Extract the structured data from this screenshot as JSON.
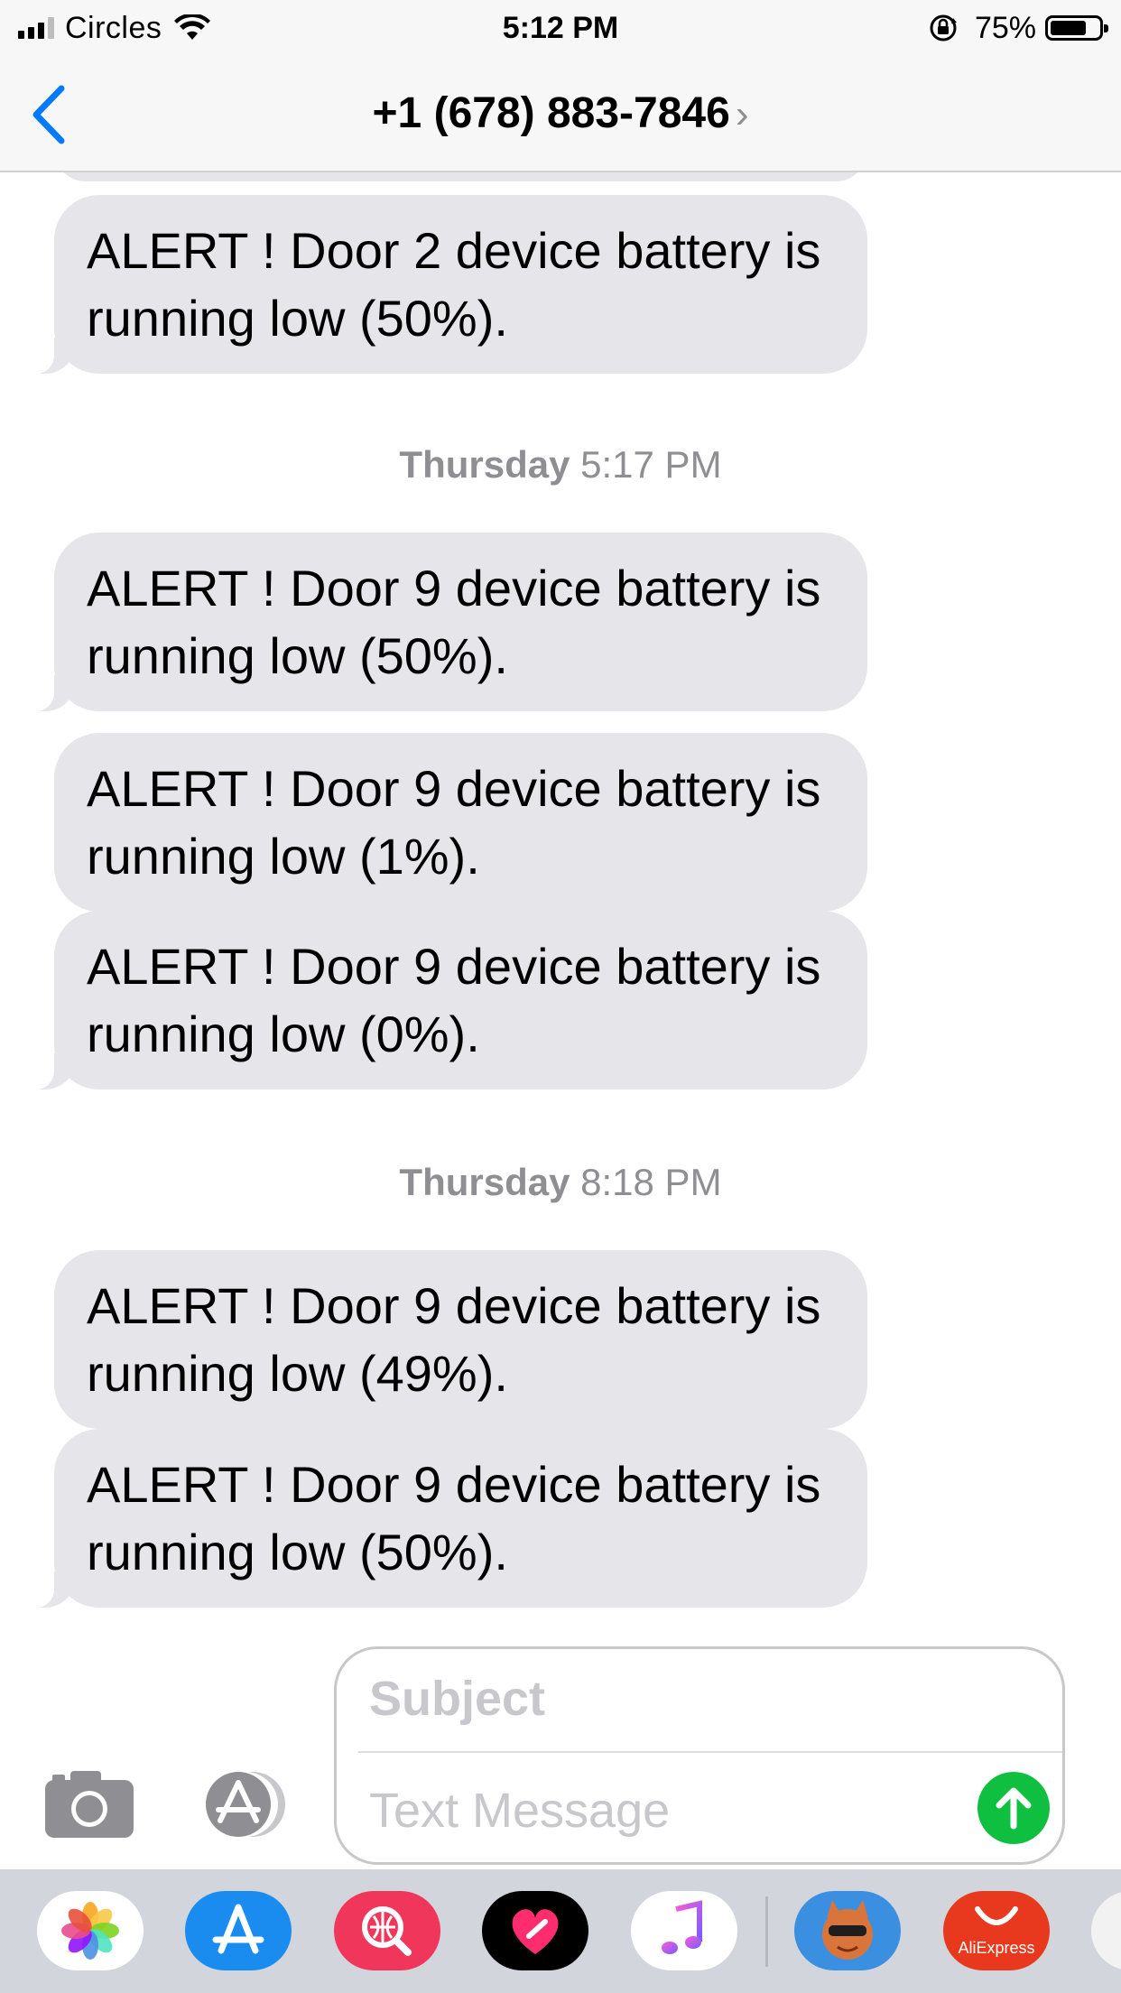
{
  "status_bar": {
    "carrier": "Circles",
    "time": "5:12 PM",
    "battery_percent": "75%",
    "battery_level": 0.75
  },
  "nav": {
    "contact": "+1 (678) 883-7846",
    "chevron": "›",
    "back_icon": "chevron-left-icon"
  },
  "messages": [
    {
      "text": "ALERT ! Door 2 device battery is running low (50%)."
    },
    {
      "text": "ALERT ! Door 9 device battery is running low (50%)."
    },
    {
      "text": "ALERT ! Door 9 device battery is running low (1%)."
    },
    {
      "text": "ALERT ! Door 9 device battery is running low (0%)."
    },
    {
      "text": "ALERT ! Door 9 device battery is running low (49%)."
    },
    {
      "text": "ALERT ! Door 9 device battery is running low (50%)."
    }
  ],
  "timestamps": [
    {
      "day": "Thursday",
      "time": "5:17 PM"
    },
    {
      "day": "Thursday",
      "time": "8:18 PM"
    }
  ],
  "composer": {
    "subject_placeholder": "Subject",
    "message_placeholder": "Text Message"
  },
  "app_drawer": {
    "apps": [
      "photos-icon",
      "app-store-icon",
      "search-web-icon",
      "digital-touch-heart-icon",
      "music-icon",
      "game-character-icon",
      "aliexpress-icon"
    ],
    "aliexpress_label": "AliExpress"
  },
  "colors": {
    "incoming_bubble": "#e5e5ea",
    "accent": "#007aff",
    "send": "#0fbf3f",
    "timestamp": "#8e8e93"
  }
}
